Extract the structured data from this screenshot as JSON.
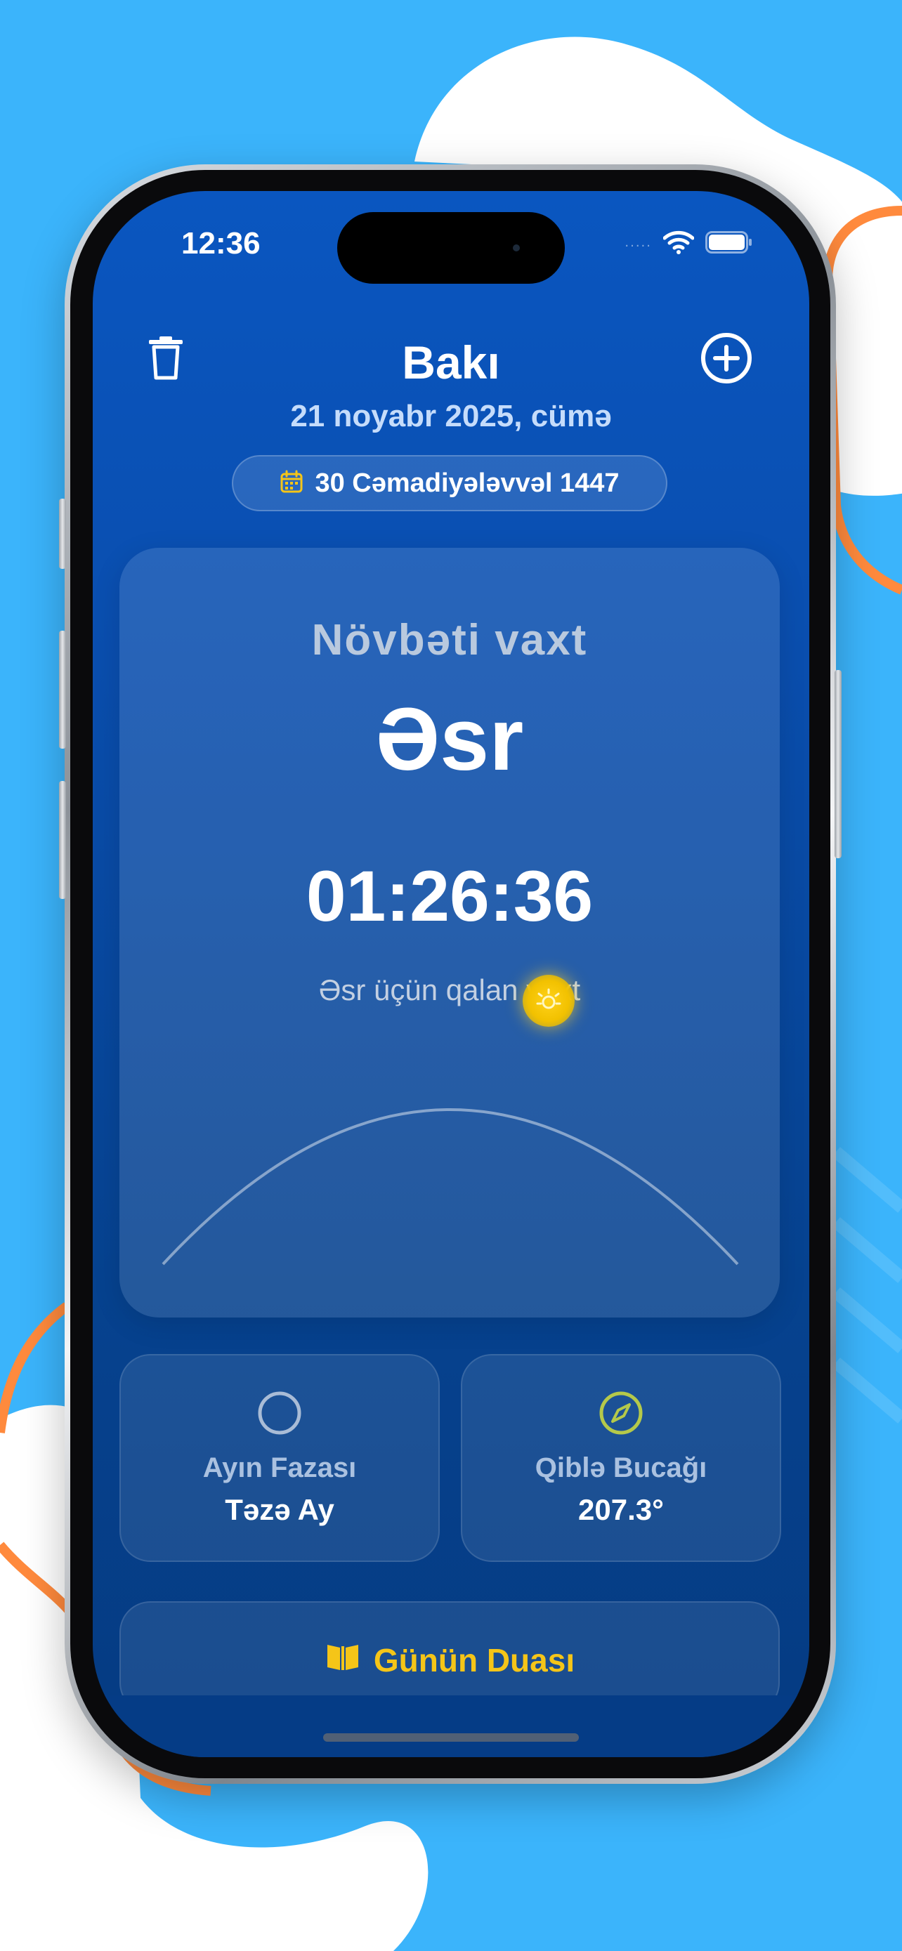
{
  "status_bar": {
    "time": "12:36",
    "signal": "....."
  },
  "header": {
    "city": "Bakı",
    "date": "21 noyabr 2025, cümə",
    "hijri_date": "30 Cəmadiyələvvəl 1447"
  },
  "next_prayer": {
    "label": "Növbəti vaxt",
    "name": "Əsr",
    "countdown": "01:26:36",
    "remaining_text": "Əsr üçün qalan vaxt"
  },
  "moon": {
    "label": "Ayın Fazası",
    "value": "Təzə Ay"
  },
  "qibla": {
    "label": "Qiblə Bucağı",
    "value": "207.3°"
  },
  "dua": {
    "title": "Günün Duası"
  },
  "icons": {
    "delete": "trash-icon",
    "add": "plus-circle-icon",
    "calendar": "calendar-icon",
    "sun": "sun-icon",
    "moon": "moon-circle-icon",
    "qibla": "compass-icon",
    "dua": "book-icon"
  },
  "colors": {
    "background": "#3bb4fb",
    "accent_orange": "#ff8a3d",
    "app_blue": "#0a4eae",
    "gold": "#f5c518"
  }
}
